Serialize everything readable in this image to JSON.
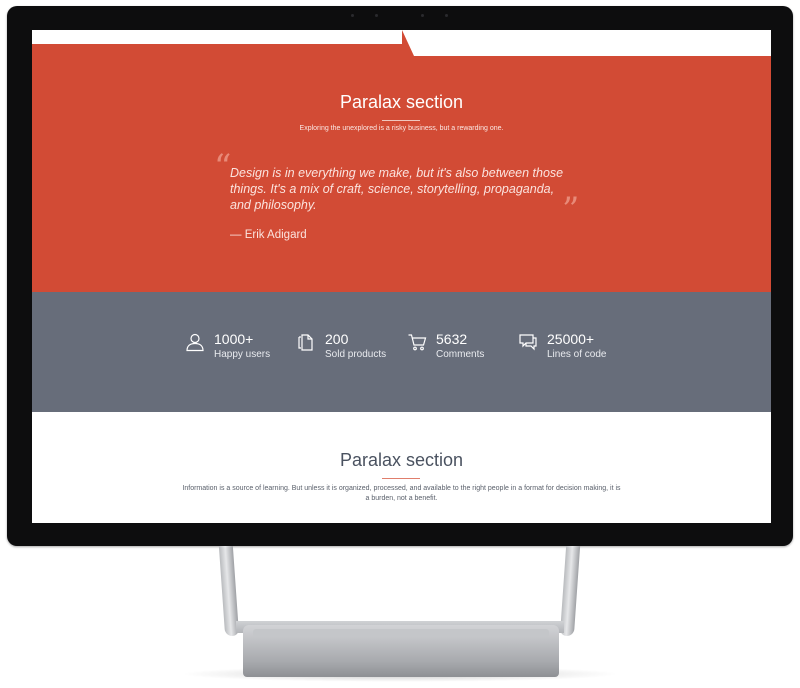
{
  "hero": {
    "title": "Paralax section",
    "subtitle": "Exploring the unexplored is a risky business, but a rewarding one.",
    "quote": "Design is in everything we make, but it's also between those things. It's a mix of craft, science, storytelling, propaganda, and philosophy.",
    "author": "— Erik Adigard",
    "accent_color": "#d24b35"
  },
  "stats": {
    "background_color": "#676d7a",
    "items": [
      {
        "icon": "user-icon",
        "value": "1000+",
        "label": "Happy users"
      },
      {
        "icon": "document-icon",
        "value": "200",
        "label": "Sold products"
      },
      {
        "icon": "cart-icon",
        "value": "5632",
        "label": "Comments"
      },
      {
        "icon": "comment-icon",
        "value": "25000+",
        "label": "Lines of code"
      }
    ]
  },
  "section": {
    "title": "Paralax section",
    "text": "Information is a source of learning. But unless it is organized, processed, and available to the right people in a format for decision making, it is a burden, not a benefit."
  }
}
